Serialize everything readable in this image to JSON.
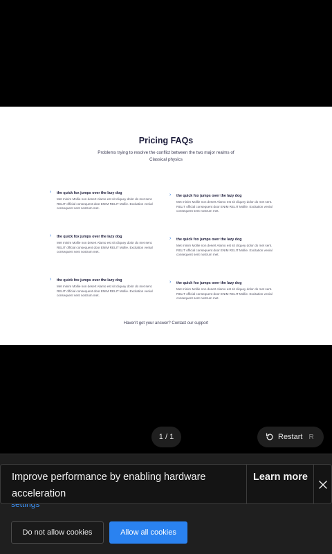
{
  "slide": {
    "title": "Pricing FAQs",
    "subtitle": "Problems trying to resolve the conflict between the two major realms of Classical physics",
    "faqs": [
      {
        "q": "the quick fox jumps over the lazy dog",
        "a": "Met minim Mollie non desert Alamo est sit cliquey dolor do met sent. RELIT official consequent door ENIM RELIT Mollie. Excitation venial consequent sent nostrum met."
      },
      {
        "q": "the quick fox jumps over the lazy dog",
        "a": "Met minim Mollie non desert Alamo est sit cliquey dolor do met sent. RELIT official consequent door ENIM RELIT Mollie. Excitation venial consequent sent nostrum met."
      },
      {
        "q": "the quick fox jumps over the lazy dog",
        "a": "Met minim Mollie non desert Alamo est sit cliquey dolor do met sent. RELIT official consequent door ENIM RELIT Mollie. Excitation venial consequent sent nostrum met."
      },
      {
        "q": "the quick fox jumps over the lazy dog",
        "a": "Met minim Mollie non desert Alamo est sit cliquey dolor do met sent. RELIT official consequent door ENIM RELIT Mollie. Excitation venial consequent sent nostrum met."
      },
      {
        "q": "the quick fox jumps over the lazy dog",
        "a": "Met minim Mollie non desert Alamo est sit cliquey dolor do met sent. RELIT official consequent door ENIM RELIT Mollie. Excitation venial consequent sent nostrum met."
      },
      {
        "q": "the quick fox jumps over the lazy dog",
        "a": "Met minim Mollie non desert Alamo est sit cliquey dolor do met sent. RELIT official consequent door ENIM RELIT Mollie. Excitation venial consequent sent nostrum met."
      }
    ],
    "footer": "Haven't got your answer? Contact our support"
  },
  "controls": {
    "pager": "1 / 1",
    "restart_label": "Restart",
    "restart_key": "R"
  },
  "cookie": {
    "settings_link": "settings",
    "deny_label": "Do not allow cookies",
    "allow_label": "Allow all cookies"
  },
  "toast": {
    "message": "Improve performance by enabling hardware acceleration",
    "learn_more": "Learn more"
  },
  "colors": {
    "accent": "#2a82f0",
    "link": "#3b8ef0",
    "dark_bg": "#1f1f1f"
  }
}
